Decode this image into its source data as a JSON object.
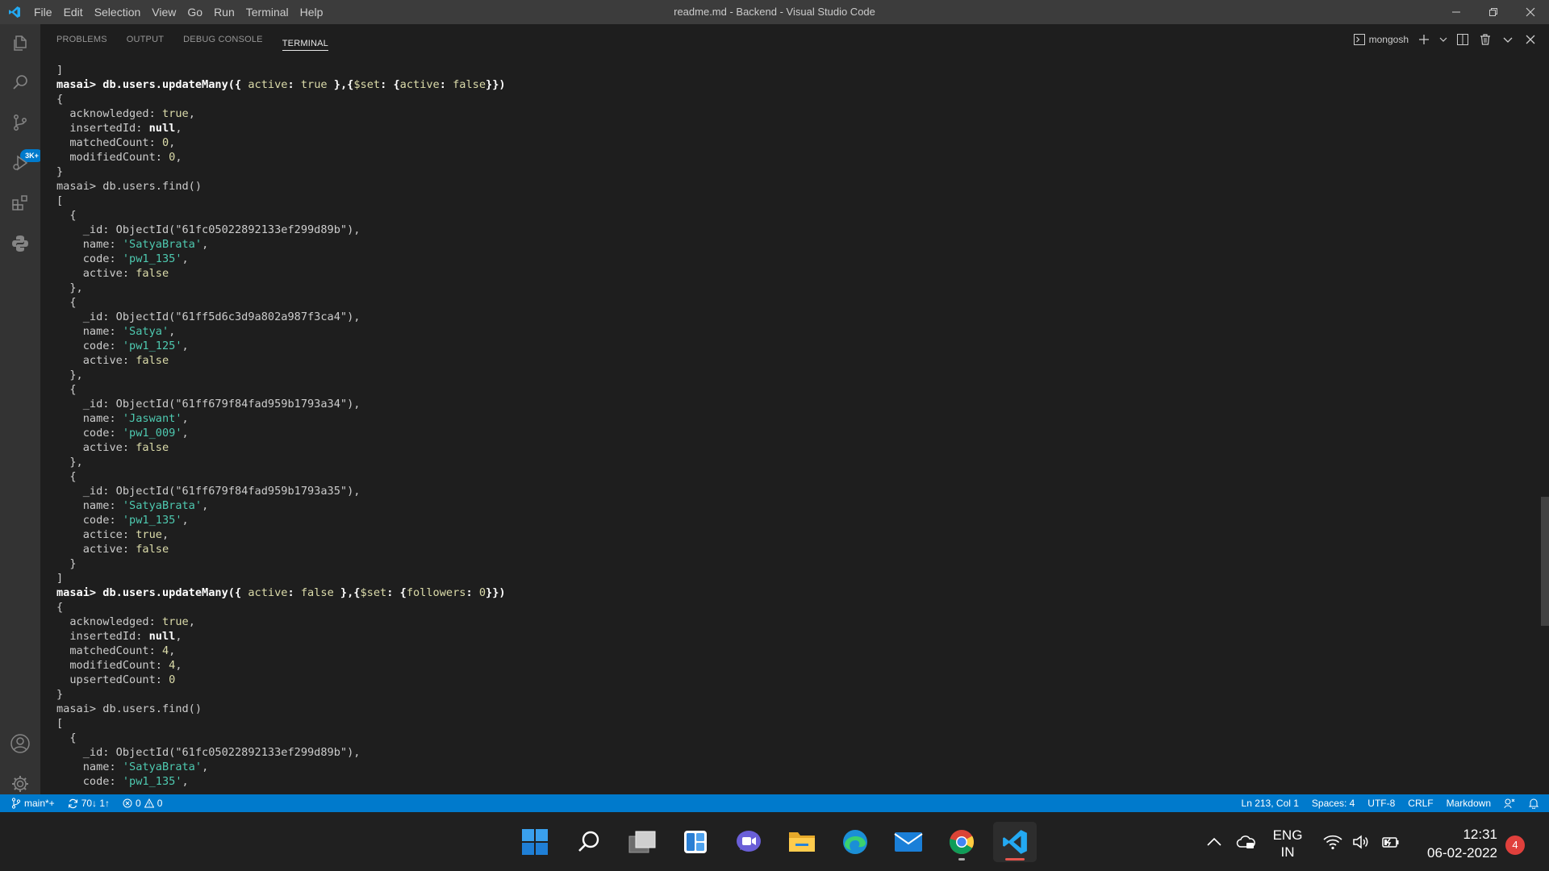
{
  "titlebar": {
    "window_title": "readme.md - Backend - Visual Studio Code",
    "menu": [
      "File",
      "Edit",
      "Selection",
      "View",
      "Go",
      "Run",
      "Terminal",
      "Help"
    ]
  },
  "activitybar": {
    "source_control_badge": "3K+"
  },
  "panel": {
    "tabs": [
      "PROBLEMS",
      "OUTPUT",
      "DEBUG CONSOLE",
      "TERMINAL"
    ],
    "active_tab": "TERMINAL",
    "terminal_name": "mongosh"
  },
  "terminal_lines": [
    [
      {
        "t": "]",
        "c": ""
      }
    ],
    [
      {
        "t": "masai> db.users.updateMany({ ",
        "c": "b"
      },
      {
        "t": "active",
        "c": "k"
      },
      {
        "t": ": ",
        "c": "b"
      },
      {
        "t": "true",
        "c": "k"
      },
      {
        "t": " },{",
        "c": "b"
      },
      {
        "t": "$set",
        "c": "k"
      },
      {
        "t": ": {",
        "c": "b"
      },
      {
        "t": "active",
        "c": "k"
      },
      {
        "t": ": ",
        "c": "b"
      },
      {
        "t": "false",
        "c": "k"
      },
      {
        "t": "}})",
        "c": "b"
      }
    ],
    [
      {
        "t": "{",
        "c": ""
      }
    ],
    [
      {
        "t": "  acknowledged: ",
        "c": ""
      },
      {
        "t": "true",
        "c": "n"
      },
      {
        "t": ",",
        "c": ""
      }
    ],
    [
      {
        "t": "  insertedId: ",
        "c": ""
      },
      {
        "t": "null",
        "c": "b"
      },
      {
        "t": ",",
        "c": ""
      }
    ],
    [
      {
        "t": "  matchedCount: ",
        "c": ""
      },
      {
        "t": "0",
        "c": "n"
      },
      {
        "t": ",",
        "c": ""
      }
    ],
    [
      {
        "t": "  modifiedCount: ",
        "c": ""
      },
      {
        "t": "0",
        "c": "n"
      },
      {
        "t": ",",
        "c": ""
      }
    ],
    [
      {
        "t": "}",
        "c": ""
      }
    ],
    [
      {
        "t": "masai> db.users.find()",
        "c": ""
      }
    ],
    [
      {
        "t": "[",
        "c": ""
      }
    ],
    [
      {
        "t": "  {",
        "c": ""
      }
    ],
    [
      {
        "t": "    _id: ObjectId(\"61fc05022892133ef299d89b\"),",
        "c": ""
      }
    ],
    [
      {
        "t": "    name: ",
        "c": ""
      },
      {
        "t": "'SatyaBrata'",
        "c": "s"
      },
      {
        "t": ",",
        "c": ""
      }
    ],
    [
      {
        "t": "    code: ",
        "c": ""
      },
      {
        "t": "'pw1_135'",
        "c": "s"
      },
      {
        "t": ",",
        "c": ""
      }
    ],
    [
      {
        "t": "    active: ",
        "c": ""
      },
      {
        "t": "false",
        "c": "n"
      }
    ],
    [
      {
        "t": "  },",
        "c": ""
      }
    ],
    [
      {
        "t": "  {",
        "c": ""
      }
    ],
    [
      {
        "t": "    _id: ObjectId(\"61ff5d6c3d9a802a987f3ca4\"),",
        "c": ""
      }
    ],
    [
      {
        "t": "    name: ",
        "c": ""
      },
      {
        "t": "'Satya'",
        "c": "s"
      },
      {
        "t": ",",
        "c": ""
      }
    ],
    [
      {
        "t": "    code: ",
        "c": ""
      },
      {
        "t": "'pw1_125'",
        "c": "s"
      },
      {
        "t": ",",
        "c": ""
      }
    ],
    [
      {
        "t": "    active: ",
        "c": ""
      },
      {
        "t": "false",
        "c": "n"
      }
    ],
    [
      {
        "t": "  },",
        "c": ""
      }
    ],
    [
      {
        "t": "  {",
        "c": ""
      }
    ],
    [
      {
        "t": "    _id: ObjectId(\"61ff679f84fad959b1793a34\"),",
        "c": ""
      }
    ],
    [
      {
        "t": "    name: ",
        "c": ""
      },
      {
        "t": "'Jaswant'",
        "c": "s"
      },
      {
        "t": ",",
        "c": ""
      }
    ],
    [
      {
        "t": "    code: ",
        "c": ""
      },
      {
        "t": "'pw1_009'",
        "c": "s"
      },
      {
        "t": ",",
        "c": ""
      }
    ],
    [
      {
        "t": "    active: ",
        "c": ""
      },
      {
        "t": "false",
        "c": "n"
      }
    ],
    [
      {
        "t": "  },",
        "c": ""
      }
    ],
    [
      {
        "t": "  {",
        "c": ""
      }
    ],
    [
      {
        "t": "    _id: ObjectId(\"61ff679f84fad959b1793a35\"),",
        "c": ""
      }
    ],
    [
      {
        "t": "    name: ",
        "c": ""
      },
      {
        "t": "'SatyaBrata'",
        "c": "s"
      },
      {
        "t": ",",
        "c": ""
      }
    ],
    [
      {
        "t": "    code: ",
        "c": ""
      },
      {
        "t": "'pw1_135'",
        "c": "s"
      },
      {
        "t": ",",
        "c": ""
      }
    ],
    [
      {
        "t": "    actice: ",
        "c": ""
      },
      {
        "t": "true",
        "c": "n"
      },
      {
        "t": ",",
        "c": ""
      }
    ],
    [
      {
        "t": "    active: ",
        "c": ""
      },
      {
        "t": "false",
        "c": "n"
      }
    ],
    [
      {
        "t": "  }",
        "c": ""
      }
    ],
    [
      {
        "t": "]",
        "c": ""
      }
    ],
    [
      {
        "t": "masai> db.users.updateMany({ ",
        "c": "b"
      },
      {
        "t": "active",
        "c": "k"
      },
      {
        "t": ": ",
        "c": "b"
      },
      {
        "t": "false",
        "c": "k"
      },
      {
        "t": " },{",
        "c": "b"
      },
      {
        "t": "$set",
        "c": "k"
      },
      {
        "t": ": {",
        "c": "b"
      },
      {
        "t": "followers",
        "c": "k"
      },
      {
        "t": ": ",
        "c": "b"
      },
      {
        "t": "0",
        "c": "k"
      },
      {
        "t": "}})",
        "c": "b"
      }
    ],
    [
      {
        "t": "{",
        "c": ""
      }
    ],
    [
      {
        "t": "  acknowledged: ",
        "c": ""
      },
      {
        "t": "true",
        "c": "n"
      },
      {
        "t": ",",
        "c": ""
      }
    ],
    [
      {
        "t": "  insertedId: ",
        "c": ""
      },
      {
        "t": "null",
        "c": "b"
      },
      {
        "t": ",",
        "c": ""
      }
    ],
    [
      {
        "t": "  matchedCount: ",
        "c": ""
      },
      {
        "t": "4",
        "c": "n"
      },
      {
        "t": ",",
        "c": ""
      }
    ],
    [
      {
        "t": "  modifiedCount: ",
        "c": ""
      },
      {
        "t": "4",
        "c": "n"
      },
      {
        "t": ",",
        "c": ""
      }
    ],
    [
      {
        "t": "  upsertedCount: ",
        "c": ""
      },
      {
        "t": "0",
        "c": "n"
      }
    ],
    [
      {
        "t": "}",
        "c": ""
      }
    ],
    [
      {
        "t": "masai> db.users.find()",
        "c": ""
      }
    ],
    [
      {
        "t": "[",
        "c": ""
      }
    ],
    [
      {
        "t": "  {",
        "c": ""
      }
    ],
    [
      {
        "t": "    _id: ObjectId(\"61fc05022892133ef299d89b\"),",
        "c": ""
      }
    ],
    [
      {
        "t": "    name: ",
        "c": ""
      },
      {
        "t": "'SatyaBrata'",
        "c": "s"
      },
      {
        "t": ",",
        "c": ""
      }
    ],
    [
      {
        "t": "    code: ",
        "c": ""
      },
      {
        "t": "'pw1_135'",
        "c": "s"
      },
      {
        "t": ",",
        "c": ""
      }
    ]
  ],
  "statusbar": {
    "branch": "main*+",
    "sync": "70↓ 1↑",
    "errors": "0",
    "warnings": "0",
    "position": "Ln 213, Col 1",
    "spaces": "Spaces: 4",
    "encoding": "UTF-8",
    "eol": "CRLF",
    "language": "Markdown"
  },
  "taskbar": {
    "lang_line1": "ENG",
    "lang_line2": "IN",
    "time": "12:31",
    "date": "06-02-2022",
    "notification_count": "4"
  },
  "colors": {
    "accent": "#007acc",
    "titlebar": "#3c3c3c",
    "activitybar": "#333333",
    "editor_bg": "#1e1e1e",
    "taskbar": "#202020"
  }
}
